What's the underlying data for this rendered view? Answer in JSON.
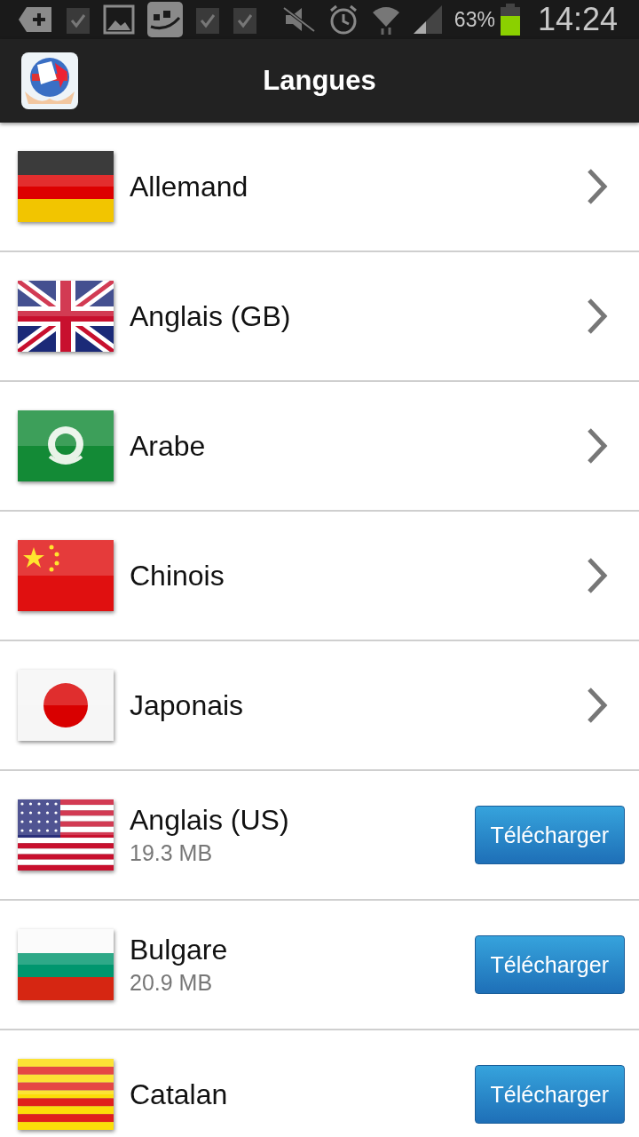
{
  "status_bar": {
    "battery": "63%",
    "time": "14:24"
  },
  "app_bar": {
    "title": "Langues"
  },
  "languages": [
    {
      "name": "Allemand",
      "flag": {
        "kind": "de"
      },
      "kind": "installed"
    },
    {
      "name": "Anglais (GB)",
      "flag": {
        "kind": "gb"
      },
      "kind": "installed"
    },
    {
      "name": "Arabe",
      "flag": {
        "kind": "arab"
      },
      "kind": "installed"
    },
    {
      "name": "Chinois",
      "flag": {
        "kind": "cn"
      },
      "kind": "installed"
    },
    {
      "name": "Japonais",
      "flag": {
        "kind": "jp"
      },
      "kind": "installed"
    },
    {
      "name": "Anglais (US)",
      "flag": {
        "kind": "us"
      },
      "kind": "download",
      "size": "19.3 MB",
      "button": "Télécharger"
    },
    {
      "name": "Bulgare",
      "flag": {
        "kind": "bg"
      },
      "kind": "download",
      "size": "20.9 MB",
      "button": "Télécharger"
    },
    {
      "name": "Catalan",
      "flag": {
        "kind": "ca"
      },
      "kind": "download",
      "button": "Télécharger"
    }
  ]
}
